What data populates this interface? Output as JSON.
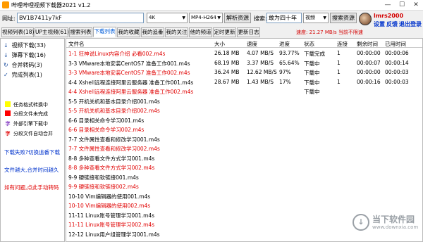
{
  "window": {
    "title": "哔哩哔哩视频下载器2021 v1.2",
    "minimize": "—",
    "maximize": "☐",
    "close": "✕"
  },
  "toolbar": {
    "url_label": "网址:",
    "url_value": "BV1B7411y7kF",
    "quality_value": "4K",
    "format_value": "MP4-H264",
    "parse_button": "解析资源",
    "search_label": "搜索:",
    "search_value": "敢为四十年",
    "search_type": "视频",
    "search_button": "搜索资源"
  },
  "user": {
    "name": "lmrs2000",
    "settings_link": "设置",
    "feedback_link": "反馈",
    "logout_link": "退出登录"
  },
  "tabs": [
    "视频列表(18)",
    "UP主视频(61)",
    "搜索列表",
    "下载列表",
    "我的收藏",
    "我的追番",
    "我的关注",
    "他的频道",
    "定时更新",
    "更新日志"
  ],
  "speed_info": "速度: 21.27 MB/s   当前不限速",
  "left_panel": {
    "items": [
      {
        "icon": "↓",
        "label": "视频下载(33)"
      },
      {
        "icon": "↓",
        "label": "弹幕下载(16)"
      },
      {
        "icon": "↻",
        "label": "合并转码(3)"
      },
      {
        "icon": "✓",
        "label": "完成列表(1)"
      }
    ],
    "legend": [
      {
        "swatch": "#ffff00",
        "label": "任务格式转换中"
      },
      {
        "swatch": "#ff0000",
        "label": "分段文件未完成"
      },
      {
        "symbol": "字",
        "symbol_color": "#7b2fbe",
        "label": "外部引擎下载中"
      },
      {
        "symbol": "字",
        "symbol_color": "#e00000",
        "label": "分段文件自动合并"
      }
    ],
    "links": [
      "下载失败?切换追番下载",
      "文件越大,合并时间越久",
      "如有问题,点此手动转码"
    ]
  },
  "table": {
    "headers": [
      "文件名",
      "大小",
      "速度",
      "进度",
      "状态",
      "连接",
      "剩余时间",
      "已用时间"
    ],
    "rows": [
      {
        "name": "1-1 狂神说Linux内容介绍 必看002.m4s",
        "size": "26.18 MB",
        "speed": "4.07 MB/S",
        "progress": "93.77%",
        "status": "下载完成",
        "conn": "1",
        "remain": "00:00:00",
        "used": "00:00:06",
        "red": true
      },
      {
        "name": "3-3 VMware本地安装CentOS7 准备工作001.m4s",
        "size": "68.19 MB",
        "speed": "3.37 MB/S",
        "progress": "65.64%",
        "status": "下载中",
        "conn": "1",
        "remain": "00:00:07",
        "used": "00:00:14",
        "red": false
      },
      {
        "name": "3-3 VMware本地安装CentOS7 准备工作002.m4s",
        "size": "36.24 MB",
        "speed": "12.62 MB/S",
        "progress": "97%",
        "status": "下载中",
        "conn": "1",
        "remain": "00:00:00",
        "used": "00:00:03",
        "red": true
      },
      {
        "name": "4-4 Xshell远程连接阿里云服务器 准备工作001.m4s",
        "size": "28.67 MB",
        "speed": "1.43 MB/S",
        "progress": "17%",
        "status": "下载中",
        "conn": "1",
        "remain": "00:00:16",
        "used": "00:00:03",
        "red": false
      },
      {
        "name": "4-4 Xshell远程连接阿里云服务器 准备工作002.m4s",
        "size": "",
        "speed": "",
        "progress": "",
        "status": "下载中",
        "conn": "",
        "remain": "",
        "used": "",
        "red": true
      },
      {
        "name": "5-5 开机关机和基本目录介绍001.m4s",
        "red": false
      },
      {
        "name": "5-5 开机关机和基本目录介绍002.m4s",
        "red": true
      },
      {
        "name": "6-6 目录相关命令学习001.m4s",
        "red": false
      },
      {
        "name": "6-6 目录相关命令学习002.m4s",
        "red": true
      },
      {
        "name": "7-7 文件属性查看和修改学习001.m4s",
        "red": false
      },
      {
        "name": "7-7 文件属性查看和修改学习002.m4s",
        "red": true
      },
      {
        "name": "8-8 多种查看文件方式学习001.m4s",
        "red": false
      },
      {
        "name": "8-8 多种查看文件方式学习002.m4s",
        "red": true
      },
      {
        "name": "9-9 硬链接和软链接001.m4s",
        "red": false
      },
      {
        "name": "9-9 硬链接和软链接002.m4s",
        "red": true
      },
      {
        "name": "10-10 Vim编辑器的使用001.m4s",
        "red": false
      },
      {
        "name": "10-10 Vim编辑器的使用002.m4s",
        "red": true
      },
      {
        "name": "11-11 Linux账号管理学习001.m4s",
        "red": false
      },
      {
        "name": "11-11 Linux账号管理学习002.m4s",
        "red": true
      },
      {
        "name": "12-12 Linux用户组管理学习001.m4s",
        "red": false
      }
    ]
  },
  "watermark": {
    "cn": "当下软件园",
    "en": "www.downxia.com"
  }
}
